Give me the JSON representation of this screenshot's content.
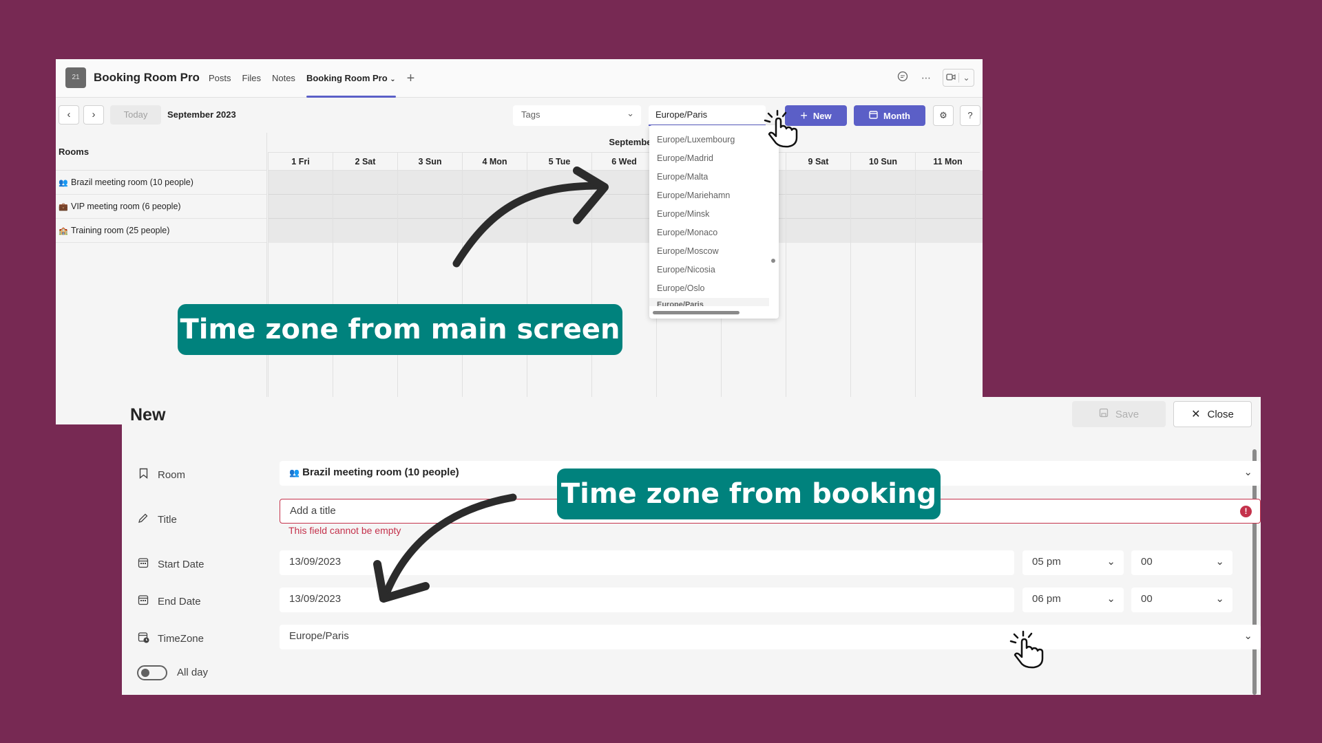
{
  "app": {
    "badge": "21",
    "title": "Booking Room Pro",
    "tabs": [
      "Posts",
      "Files",
      "Notes"
    ],
    "active_tab": "Booking Room Pro",
    "add_tab": "+"
  },
  "toolbar": {
    "prev": "‹",
    "next": "›",
    "today": "Today",
    "month_label": "September 2023",
    "tags_placeholder": "Tags",
    "timezone_value": "Europe/Paris",
    "new_label": "New",
    "month_button": "Month"
  },
  "calendar": {
    "rooms_header": "Rooms",
    "month_header": "September",
    "days": [
      "1 Fri",
      "2 Sat",
      "3 Sun",
      "4 Mon",
      "5 Tue",
      "6 Wed",
      "",
      "",
      "9 Sat",
      "10 Sun",
      "11 Mon"
    ],
    "rooms": [
      {
        "icon": "👥",
        "name": "Brazil meeting room (10 people)"
      },
      {
        "icon": "💼",
        "name": "VIP meeting room (6 people)"
      },
      {
        "icon": "🏫",
        "name": "Training room (25 people)"
      }
    ]
  },
  "timezone_dropdown": {
    "items": [
      "Europe/Luxembourg",
      "Europe/Madrid",
      "Europe/Malta",
      "Europe/Mariehamn",
      "Europe/Minsk",
      "Europe/Monaco",
      "Europe/Moscow",
      "Europe/Nicosia",
      "Europe/Oslo"
    ],
    "partial_item": "Europe/Paris"
  },
  "form": {
    "title": "New",
    "save": "Save",
    "close": "Close",
    "room_label": "Room",
    "room_value": "Brazil meeting room (10 people)",
    "title_label": "Title",
    "title_placeholder": "Add a title",
    "title_error": "This field cannot be empty",
    "start_label": "Start Date",
    "start_date": "13/09/2023",
    "start_hour": "05 pm",
    "start_min": "00",
    "end_label": "End Date",
    "end_date": "13/09/2023",
    "end_hour": "06 pm",
    "end_min": "00",
    "tz_label": "TimeZone",
    "tz_value": "Europe/Paris",
    "allday_label": "All day",
    "allday_on": false
  },
  "callouts": {
    "main": "Time zone from main screen",
    "booking": "Time zone from booking"
  },
  "colors": {
    "background": "#772953",
    "accent": "#5b5fc7",
    "callout": "#00827d",
    "error": "#c4314b"
  }
}
